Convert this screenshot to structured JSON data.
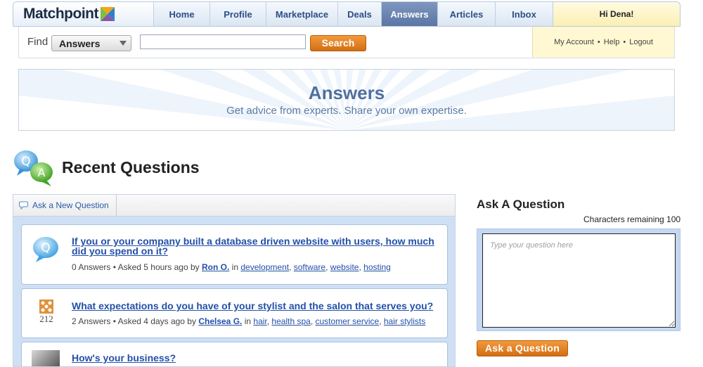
{
  "header": {
    "logo_text": "Matchpoint",
    "nav": [
      {
        "label": "Home"
      },
      {
        "label": "Profile"
      },
      {
        "label": "Marketplace"
      },
      {
        "label": "Deals"
      },
      {
        "label": "Answers"
      },
      {
        "label": "Articles"
      },
      {
        "label": "Inbox"
      }
    ],
    "active_nav": "Answers",
    "greeting": "Hi Dena!"
  },
  "search": {
    "find_label": "Find",
    "scope_value": "Answers",
    "input_value": "",
    "button_label": "Search"
  },
  "account": {
    "my_account": "My Account",
    "separator": "•",
    "help": "Help",
    "logout": "Logout"
  },
  "hero": {
    "title": "Answers",
    "subtitle": "Get advice from experts. Share your own expertise."
  },
  "section": {
    "title": "Recent Questions",
    "ask_new_label": "Ask a New Question"
  },
  "questions": [
    {
      "title": "If you or your company built a database driven website with users, how much did you spend on it?",
      "answers": "0 Answers",
      "asked": "• Asked 5 hours ago by",
      "author": "Ron O.",
      "in": "in",
      "tags": [
        "development",
        "software",
        "website",
        "hosting"
      ]
    },
    {
      "title": "What expectations do you have of your stylist and the salon that serves you?",
      "answers": "2 Answers",
      "asked": "• Asked 4 days ago by",
      "author": "Chelsea G.",
      "in": "in",
      "tags": [
        "hair",
        "health spa",
        "customer service",
        "hair stylists"
      ],
      "thumb_text": "212"
    },
    {
      "title": "How's your business?"
    }
  ],
  "ask": {
    "title": "Ask A Question",
    "chars_remaining": "Characters remaining 100",
    "placeholder": "Type your question here",
    "button_label": "Ask a Question"
  },
  "colors": {
    "nav_active": "#5a76a5",
    "link": "#2350a8",
    "button_orange": "#e07f22",
    "panel_blue": "#cfe0f5",
    "greeting_yellow": "#fbefb4"
  },
  "icons": {
    "logo_mark": "x-mark-logo-icon",
    "chevron": "chevron-down-icon",
    "speech": "speech-bubble-icon",
    "qa": "qa-bubbles-icon"
  }
}
